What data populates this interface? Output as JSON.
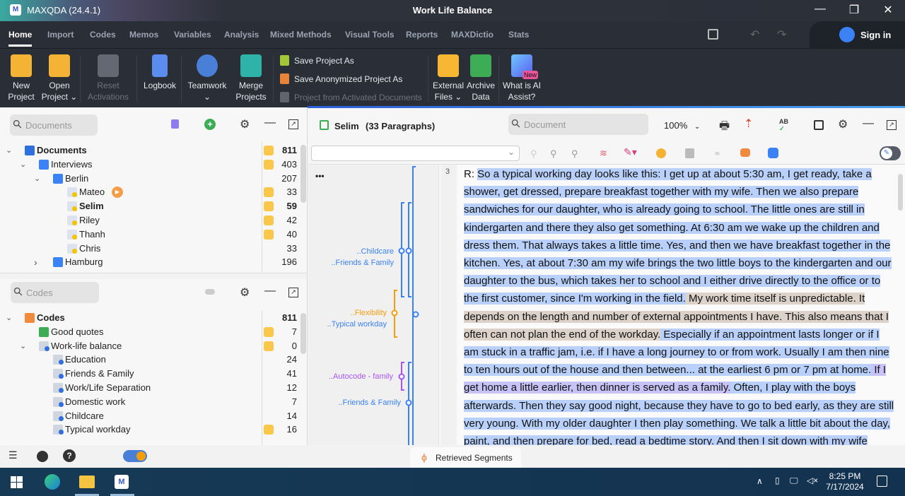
{
  "window": {
    "app_title": "MAXQDA (24.4.1)",
    "project_title": "Work Life Balance"
  },
  "menu": {
    "tabs": [
      "Home",
      "Import",
      "Codes",
      "Memos",
      "Variables",
      "Analysis",
      "Mixed Methods",
      "Visual Tools",
      "Reports",
      "MAXDictio",
      "Stats"
    ],
    "sign_in": "Sign in"
  },
  "ribbon": {
    "new_project": [
      "New",
      "Project"
    ],
    "open_project": [
      "Open",
      "Project ⌄"
    ],
    "reset_activations": [
      "Reset",
      "Activations"
    ],
    "logbook": "Logbook",
    "teamwork": [
      "Teamwork",
      "⌄"
    ],
    "merge_projects": [
      "Merge",
      "Projects"
    ],
    "save_project_as": "Save Project As",
    "save_anonymized": "Save Anonymized Project As",
    "project_from_activated": "Project from Activated Documents",
    "external_files": [
      "External",
      "Files ⌄"
    ],
    "archive_data": [
      "Archive",
      "Data"
    ],
    "ai_assist": [
      "What is AI",
      "Assist?"
    ],
    "new_badge": "New"
  },
  "documents": {
    "search_placeholder": "Documents",
    "rows": [
      {
        "label": "Documents",
        "count": "811"
      },
      {
        "label": "Interviews",
        "count": "403"
      },
      {
        "label": "Berlin",
        "count": "207"
      },
      {
        "label": "Mateo",
        "count": "33"
      },
      {
        "label": "Selim",
        "count": "59"
      },
      {
        "label": "Riley",
        "count": "42"
      },
      {
        "label": "Thanh",
        "count": "40"
      },
      {
        "label": "Chris",
        "count": "33"
      },
      {
        "label": "Hamburg",
        "count": "196"
      }
    ]
  },
  "codes": {
    "search_placeholder": "Codes",
    "rows": [
      {
        "label": "Codes",
        "count": "811"
      },
      {
        "label": "Good quotes",
        "count": "7"
      },
      {
        "label": "Work-life balance",
        "count": "0"
      },
      {
        "label": "Education",
        "count": "24"
      },
      {
        "label": "Friends & Family",
        "count": "41"
      },
      {
        "label": "Work/Life Separation",
        "count": "12"
      },
      {
        "label": "Domestic work",
        "count": "7"
      },
      {
        "label": "Childcare",
        "count": "14"
      },
      {
        "label": "Typical workday",
        "count": "16"
      }
    ]
  },
  "document_browser": {
    "doc_name": "Selim",
    "paragraphs": "(33 Paragraphs)",
    "search_placeholder": "Document",
    "zoom": "100%",
    "paragraph_number": "3",
    "more": "•••",
    "code_labels": [
      "..Childcare",
      "..Friends & Family",
      "..Flexibility",
      "..Typical workday",
      "..Autocode - family",
      "..Friends & Family"
    ],
    "speaker": "R:",
    "segments": [
      {
        "style": "hb",
        "text": "So a typical working day looks like this: I get up at about 5:30 am, I get ready, take a shower, get dressed, prepare breakfast together with my wife. Then we also prepare sandwiches for our daughter, who is already going to school. The little ones are still in kindergarten and there they also get something. At 6:30 am we wake up the children and dress them. That always takes a little time. Yes, and then we have breakfast together in the kitchen. Yes, at about 7:30 am my wife brings the two little boys to the kindergarten and our daughter to the bus, which takes her to school and I either drive directly to the office or to the first customer, since I'm working in the field."
      },
      {
        "style": "ht",
        "text": " My work time itself is unpredictable. It depends on the length and number of external appointments I have. This also means that I often can not plan the end of the workday."
      },
      {
        "style": "hb",
        "text": " Especially if an appointment lasts longer or if I am stuck in a traffic jam, i.e. if I have a long journey to or from work. Usually I am then nine to ten hours out of the house and then between... at the earliest 6 pm or 7 pm at home."
      },
      {
        "style": "hl",
        "text": " If I get home a little earlier, then dinner is served as a family."
      },
      {
        "style": "hb",
        "text": " Often, I play with the boys afterwards. Then they say good night, because they have to go to bed early, as they are still very young. With my older daughter I then play something. We talk a little bit about the day, paint, and then prepare for bed, read a bedtime story. And then I sit down with my wife again to talk about"
      }
    ]
  },
  "bottom": {
    "retrieved_segments": "Retrieved Segments"
  },
  "taskbar": {
    "time": "8:25 PM",
    "date": "7/17/2024"
  },
  "colors": {
    "accent": "#3b82f6",
    "highlight_blue": "#b9d1fa",
    "highlight_tan": "#dcd2c9",
    "highlight_lavender": "#c7c3f7",
    "flexibility": "#f59e0b",
    "autocode": "#a855f7"
  }
}
